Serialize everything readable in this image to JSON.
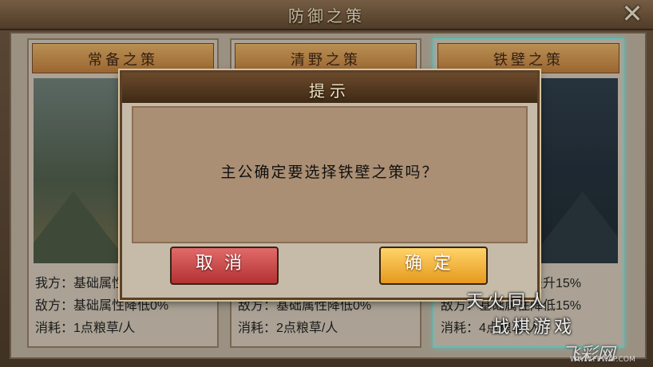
{
  "window": {
    "title": "防御之策",
    "close_glyph": "✕"
  },
  "cards": [
    {
      "title": "常备之策",
      "lines": [
        "我方：基础属性",
        "敌方：基础属性降低0%",
        "消耗：1点粮草/人"
      ]
    },
    {
      "title": "清野之策",
      "lines": [
        "",
        "敌方：基础属性降低0%",
        "消耗：2点粮草/人"
      ]
    },
    {
      "title": "铁壁之策",
      "lines": [
        "我方：基础属性提升15%",
        "敌方：基础属性降低15%",
        "消耗：4点粮草/人"
      ],
      "selected": true
    }
  ],
  "dialog": {
    "title": "提示",
    "message": "主公确定要选择铁壁之策吗？",
    "cancel_label": "取消",
    "confirm_label": "确定"
  },
  "watermark": {
    "line1": "天火同人",
    "line2": "战棋游戏",
    "site_logo": "飞彩网",
    "site_url": "WWW.FPWAP.COM"
  },
  "colors": {
    "selected_border": "#6fe0d8",
    "cancel_button": "#c84444",
    "confirm_button": "#f0b43a"
  }
}
